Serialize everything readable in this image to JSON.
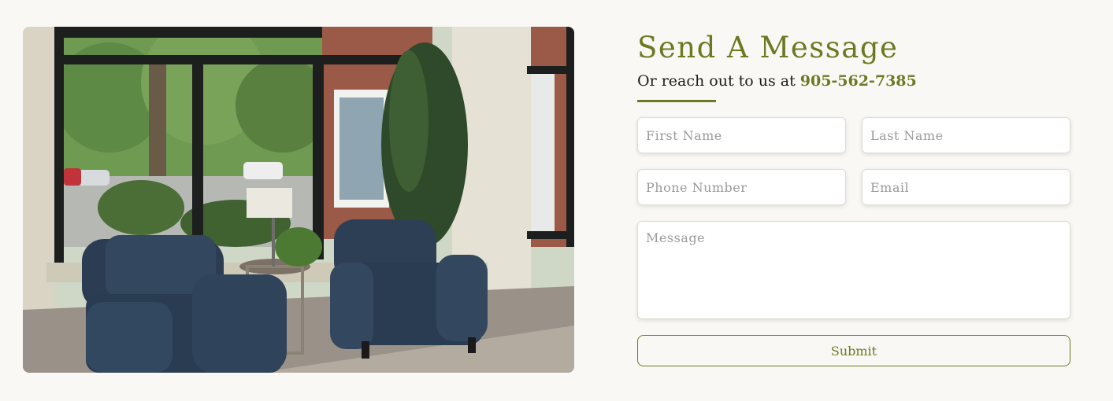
{
  "photo": {
    "description_icon": "lounge-photo"
  },
  "contact": {
    "heading": "Send A Message",
    "subtitle_prefix": "Or reach out to us at ",
    "phone": "905-562-7385"
  },
  "form": {
    "first_name_placeholder": "First Name",
    "last_name_placeholder": "Last Name",
    "phone_placeholder": "Phone Number",
    "email_placeholder": "Email",
    "message_placeholder": "Message",
    "submit_label": "Submit"
  },
  "colors": {
    "accent": "#6b7a22",
    "background": "#f9f8f4"
  }
}
